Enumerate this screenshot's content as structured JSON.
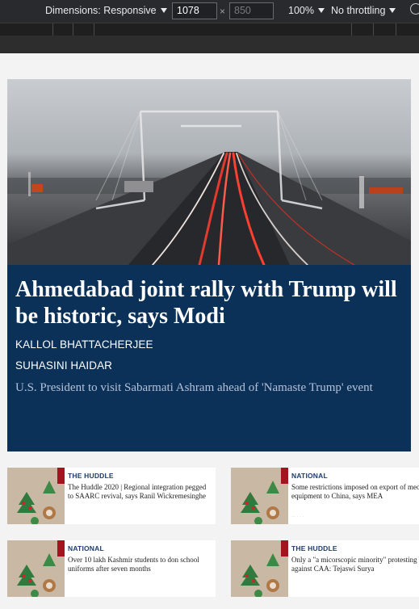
{
  "devtools": {
    "dimensions_label": "Dimensions: Responsive",
    "width_value": "1078",
    "height_value": "850",
    "times_sign": "×",
    "zoom_label": "100%",
    "throttle_label": "No throttling"
  },
  "hero": {
    "headline": "Ahmedabad joint rally with Trump will be historic, says Modi",
    "authors": [
      "KALLOL BHATTACHERJEE",
      "SUHASINI HAIDAR"
    ],
    "subhead": "U.S. President to visit Sabarmati Ashram ahead of 'Namaste Trump' event"
  },
  "cards": [
    {
      "kicker": "THE HUDDLE",
      "headline": "The Huddle 2020 | Regional integration pegged to SAARC revival, says Ranil Wickremesinghe"
    },
    {
      "kicker": "NATIONAL",
      "headline": "Some restrictions imposed on export of medical equipment to China, says MEA",
      "faint": "... . . ."
    },
    {
      "kicker": "NATIONAL",
      "headline": "Over 10 lakh Kashmir students to don school uniforms after seven months"
    },
    {
      "kicker": "THE HUDDLE",
      "headline": "Only a \"a micorscopic minority\" protesting against CAA: Tejaswi Surya"
    }
  ],
  "colors": {
    "hero_bg": "#0b3158",
    "kicker": "#1d3b6b",
    "thumb_accent": "#a3141f"
  }
}
